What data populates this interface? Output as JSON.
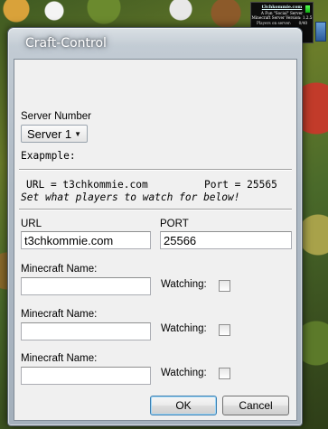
{
  "widget": {
    "site": "t3chkommie.com",
    "line1": "A Fun \"Social\" Server",
    "line2": "Minecraft Server Version: 1.2.5",
    "players_label": "Players on server:",
    "players_value": "0/40"
  },
  "window": {
    "title": "Craft-Control"
  },
  "server": {
    "label": "Server Number",
    "selected": "Server 1"
  },
  "example": {
    "heading": "Exapmple:",
    "url_text": "URL = t3chkommie.com",
    "port_text": "Port = 25565",
    "instruction": "Set what players to watch for below!"
  },
  "connection": {
    "url_label": "URL",
    "url_value": "t3chkommie.com",
    "port_label": "PORT",
    "port_value": "25566"
  },
  "players": [
    {
      "name_label": "Minecraft Name:",
      "name_value": "",
      "watching_label": "Watching:",
      "watching": false
    },
    {
      "name_label": "Minecraft Name:",
      "name_value": "",
      "watching_label": "Watching:",
      "watching": false
    },
    {
      "name_label": "Minecraft Name:",
      "name_value": "",
      "watching_label": "Watching:",
      "watching": false
    }
  ],
  "buttons": {
    "ok": "OK",
    "cancel": "Cancel"
  }
}
